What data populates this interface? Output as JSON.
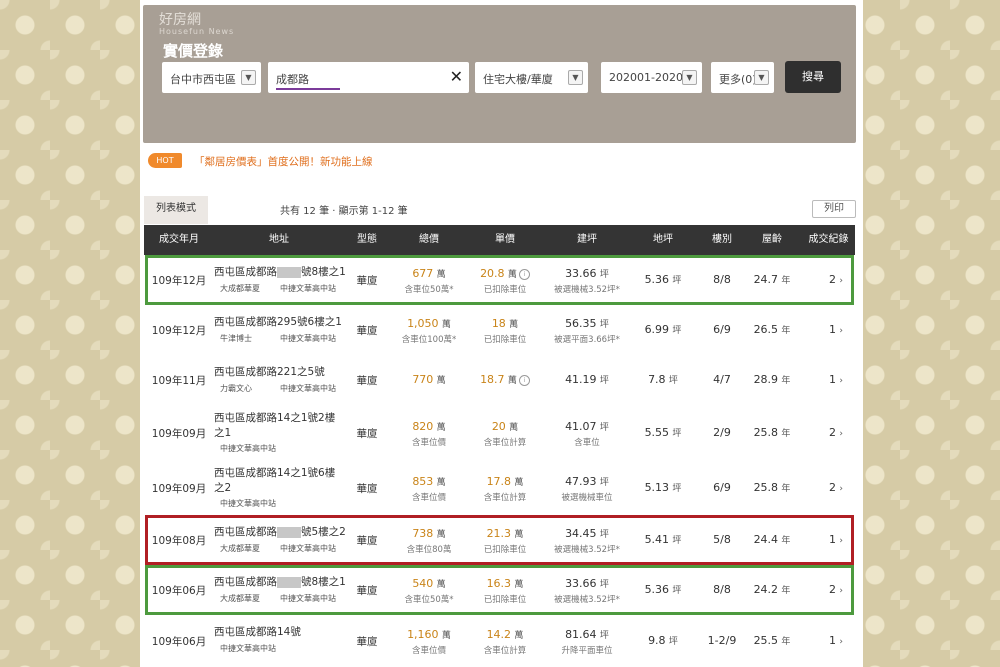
{
  "header": {
    "logo_name": "好房網",
    "logo_sub": "Housefun News",
    "title": "實價登錄"
  },
  "search": {
    "district": "台中市西屯區",
    "keyword": "成都路",
    "building_type": "住宅大樓/華廈",
    "date_range": "202001-202012",
    "more": "更多(0)",
    "button": "搜尋"
  },
  "promo": {
    "badge": "HOT",
    "text": "「鄰居房價表」首度公開！新功能上線"
  },
  "list": {
    "tab_label": "列表模式",
    "count_text": "共有 12 筆 ‧ 顯示第 1-12 筆",
    "print_label": "列印",
    "columns": [
      "成交年月",
      "地址",
      "型態",
      "總價",
      "單價",
      "建坪",
      "地坪",
      "樓別",
      "屋齡",
      "成交紀錄"
    ],
    "rows": [
      {
        "date": "109年12月",
        "addr1": "西屯區成都路",
        "addr2": "號8樓之1",
        "masked": true,
        "addr_wrap": "",
        "community": "大成都華夏",
        "station": "中捷文華高中站",
        "type": "華廈",
        "total": "677",
        "total_note": "含車位50萬*",
        "unit": "20.8",
        "unit_info": true,
        "unit_note": "已扣除車位",
        "building": "33.66",
        "building_note": "被選機械3.52坪*",
        "land": "5.36",
        "floor": "8/8",
        "age": "24.7",
        "records": "2"
      },
      {
        "date": "109年12月",
        "addr1": "西屯區成都路295號6樓之1",
        "addr2": "",
        "masked": false,
        "addr_wrap": "",
        "community": "牛津博士",
        "station": "中捷文華高中站",
        "type": "華廈",
        "total": "1,050",
        "total_note": "含車位100萬*",
        "unit": "18",
        "unit_info": false,
        "unit_note": "已扣除車位",
        "building": "56.35",
        "building_note": "被選平面3.66坪*",
        "land": "6.99",
        "floor": "6/9",
        "age": "26.5",
        "records": "1"
      },
      {
        "date": "109年11月",
        "addr1": "西屯區成都路221之5號",
        "addr2": "",
        "masked": false,
        "addr_wrap": "",
        "community": "力霸文心",
        "station": "中捷文華高中站",
        "type": "華廈",
        "total": "770",
        "total_note": "",
        "unit": "18.7",
        "unit_info": true,
        "unit_note": "",
        "building": "41.19",
        "building_note": "",
        "land": "7.8",
        "floor": "4/7",
        "age": "28.9",
        "records": "1"
      },
      {
        "date": "109年09月",
        "addr1": "西屯區成都路14之1號2樓",
        "addr2": "",
        "masked": false,
        "addr_wrap": "之1",
        "community": "",
        "station": "中捷文華高中站",
        "type": "華廈",
        "total": "820",
        "total_note": "含車位價",
        "unit": "20",
        "unit_info": false,
        "unit_note": "含車位計算",
        "building": "41.07",
        "building_note": "含車位",
        "land": "5.55",
        "floor": "2/9",
        "age": "25.8",
        "records": "2"
      },
      {
        "date": "109年09月",
        "addr1": "西屯區成都路14之1號6樓",
        "addr2": "",
        "masked": false,
        "addr_wrap": "之2",
        "community": "",
        "station": "中捷文華高中站",
        "type": "華廈",
        "total": "853",
        "total_note": "含車位價",
        "unit": "17.8",
        "unit_info": false,
        "unit_note": "含車位計算",
        "building": "47.93",
        "building_note": "被選機械車位",
        "land": "5.13",
        "floor": "6/9",
        "age": "25.8",
        "records": "2"
      },
      {
        "date": "109年08月",
        "addr1": "西屯區成都路",
        "addr2": "號5樓之2",
        "masked": true,
        "addr_wrap": "",
        "community": "大成都華夏",
        "station": "中捷文華高中站",
        "type": "華廈",
        "total": "738",
        "total_note": "含車位80萬",
        "unit": "21.3",
        "unit_info": false,
        "unit_note": "已扣除車位",
        "building": "34.45",
        "building_note": "被選機械3.52坪*",
        "land": "5.41",
        "floor": "5/8",
        "age": "24.4",
        "records": "1"
      },
      {
        "date": "109年06月",
        "addr1": "西屯區成都路",
        "addr2": "號8樓之1",
        "masked": true,
        "addr_wrap": "",
        "community": "大成都華夏",
        "station": "中捷文華高中站",
        "type": "華廈",
        "total": "540",
        "total_note": "含車位50萬*",
        "unit": "16.3",
        "unit_info": false,
        "unit_note": "已扣除車位",
        "building": "33.66",
        "building_note": "被選機械3.52坪*",
        "land": "5.36",
        "floor": "8/8",
        "age": "24.2",
        "records": "2"
      },
      {
        "date": "109年06月",
        "addr1": "西屯區成都路14號",
        "addr2": "",
        "masked": false,
        "addr_wrap": "",
        "community": "",
        "station": "中捷文華高中站",
        "type": "華廈",
        "total": "1,160",
        "total_note": "含車位價",
        "unit": "14.2",
        "unit_info": false,
        "unit_note": "含車位計算",
        "building": "81.64",
        "building_note": "升降平面車位",
        "land": "9.8",
        "floor": "1-2/9",
        "age": "25.5",
        "records": "1"
      }
    ],
    "units": {
      "wan": "萬",
      "ping": "坪",
      "year": "年",
      "arrow": "›"
    }
  },
  "highlights": {
    "green_color": "#4d9a3e",
    "red_color": "#b01f24",
    "green_rows": [
      0,
      6
    ],
    "red_rows": [
      5
    ]
  },
  "colors": {
    "search_bg": "#a89f95",
    "price_orange": "#c98419",
    "header_dark": "#343434",
    "hot_orange": "#f08a2c"
  }
}
